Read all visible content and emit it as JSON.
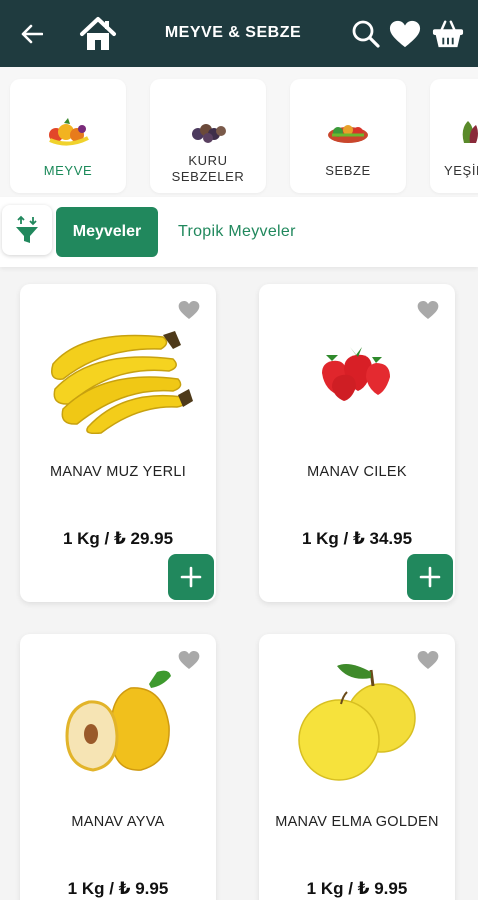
{
  "header": {
    "title": "MEYVE & SEBZE"
  },
  "categories": [
    {
      "label": "MEYVE",
      "active": true
    },
    {
      "label": "KURU\nSEBZELER",
      "active": false
    },
    {
      "label": "SEBZE",
      "active": false
    },
    {
      "label": "YEŞİL",
      "active": false
    }
  ],
  "tabs": {
    "active": "Meyveler",
    "other": "Tropik Meyveler"
  },
  "products": [
    {
      "name": "MANAV MUZ YERLI",
      "price": "1 Kg / ₺ 29.95"
    },
    {
      "name": "MANAV CILEK",
      "price": "1 Kg / ₺ 34.95"
    },
    {
      "name": "MANAV AYVA",
      "price": "1 Kg / ₺ 9.95"
    },
    {
      "name": "MANAV ELMA GOLDEN",
      "price": "1 Kg / ₺ 9.95"
    }
  ],
  "colors": {
    "header_bg": "#1f3b3f",
    "accent": "#21885d"
  },
  "icons": [
    "arrow-left-icon",
    "home-icon",
    "search-icon",
    "heart-icon",
    "basket-icon",
    "filter-icon",
    "plus-icon"
  ]
}
